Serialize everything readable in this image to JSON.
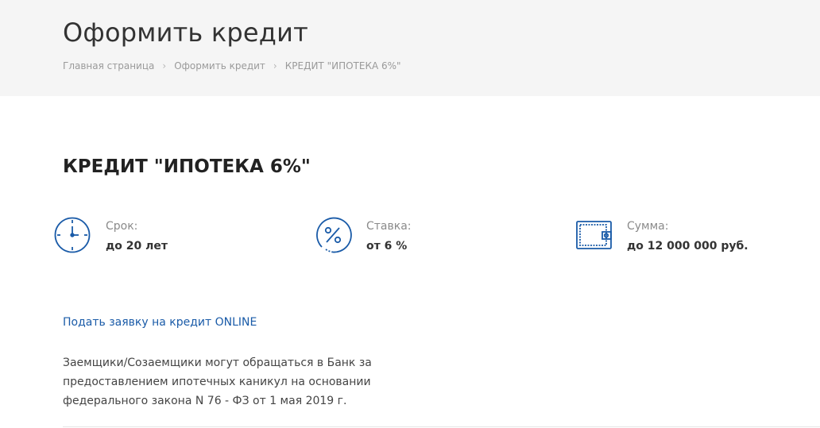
{
  "header": {
    "title": "Оформить кредит",
    "breadcrumb": [
      "Главная страница",
      "Оформить кредит",
      "КРЕДИТ \"ИПОТЕКА 6%\""
    ]
  },
  "product": {
    "title": "КРЕДИТ \"ИПОТЕКА 6%\"",
    "features": [
      {
        "icon": "clock-icon",
        "label": "Срок:",
        "value": "до 20 лет"
      },
      {
        "icon": "percent-icon",
        "label": "Ставка:",
        "value": "от 6 %"
      },
      {
        "icon": "wallet-icon",
        "label": "Сумма:",
        "value": "до 12 000 000 руб."
      }
    ],
    "apply_link": "Подать заявку на кредит ONLINE",
    "info_text": "Заемщики/Созаемщики могут обращаться в Банк за предоставлением ипотечных каникул на основании федерального закона N 76 - ФЗ от 1 мая 2019 г."
  },
  "colors": {
    "accent": "#1a5ba8",
    "header_bg": "#f5f5f5"
  }
}
